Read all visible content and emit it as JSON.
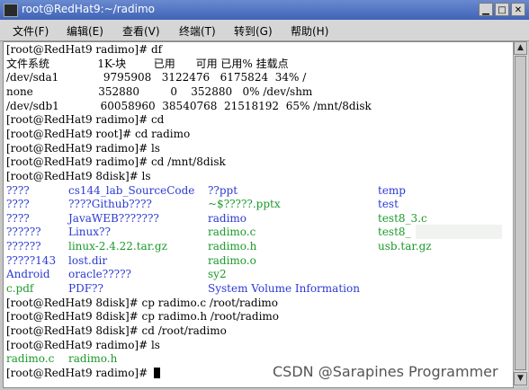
{
  "window": {
    "title": "root@RedHat9:~/radimo"
  },
  "menu": [
    {
      "label": "文件(F)"
    },
    {
      "label": "编辑(E)"
    },
    {
      "label": "查看(V)"
    },
    {
      "label": "终端(T)"
    },
    {
      "label": "转到(G)"
    },
    {
      "label": "帮助(H)"
    }
  ],
  "colors": {
    "dir": "#2a3ad0",
    "file": "#1a9a2a",
    "text": "#000000"
  },
  "terminal": {
    "lines": [
      "[root@RedHat9 radimo]# df",
      "文件系统              1K-块        已用      可用 已用% 挂载点",
      "/dev/sda1             9795908   3122476   6175824  34% /",
      "none                   352880         0    352880   0% /dev/shm",
      "/dev/sdb1            60058960  38540768  21518192  65% /mnt/8disk",
      "[root@RedHat9 radimo]# cd",
      "[root@RedHat9 root]# cd radimo",
      "[root@RedHat9 radimo]# ls",
      "[root@RedHat9 radimo]# cd /mnt/8disk",
      "[root@RedHat9 8disk]# ls"
    ],
    "ls_rows": [
      [
        {
          "t": "????",
          "c": "dir"
        },
        {
          "t": "cs144_lab_SourceCode",
          "c": "dir"
        },
        {
          "t": "??ppt",
          "c": "dir"
        },
        {
          "t": "temp",
          "c": "dir"
        }
      ],
      [
        {
          "t": "????",
          "c": "dir"
        },
        {
          "t": "????Github????",
          "c": "dir"
        },
        {
          "t": "~$?????.pptx",
          "c": "file"
        },
        {
          "t": "test",
          "c": "dir"
        }
      ],
      [
        {
          "t": "????",
          "c": "dir"
        },
        {
          "t": "JavaWEB???????",
          "c": "dir"
        },
        {
          "t": "radimo",
          "c": "dir"
        },
        {
          "t": "test8_3.c",
          "c": "file"
        }
      ],
      [
        {
          "t": "??????",
          "c": "dir"
        },
        {
          "t": "Linux??",
          "c": "dir"
        },
        {
          "t": "radimo.c",
          "c": "file"
        },
        {
          "t": "test8_",
          "c": "file"
        }
      ],
      [
        {
          "t": "??????",
          "c": "dir"
        },
        {
          "t": "linux-2.4.22.tar.gz",
          "c": "file"
        },
        {
          "t": "radimo.h",
          "c": "file"
        },
        {
          "t": "usb.tar.gz",
          "c": "file"
        }
      ],
      [
        {
          "t": "?????143",
          "c": "dir"
        },
        {
          "t": "lost.dir",
          "c": "dir"
        },
        {
          "t": "radimo.o",
          "c": "file"
        },
        {
          "t": "",
          "c": "file"
        }
      ],
      [
        {
          "t": "Android",
          "c": "dir"
        },
        {
          "t": "oracle?????",
          "c": "dir"
        },
        {
          "t": "sy2",
          "c": "file"
        },
        {
          "t": "",
          "c": "file"
        }
      ],
      [
        {
          "t": "c.pdf",
          "c": "file"
        },
        {
          "t": "PDF??",
          "c": "dir"
        },
        {
          "t": "System Volume Information",
          "c": "dir"
        },
        {
          "t": "",
          "c": "file"
        }
      ]
    ],
    "after_lines": [
      "[root@RedHat9 8disk]# cp radimo.c /root/radimo",
      "[root@RedHat9 8disk]# cp radimo.h /root/radimo",
      "[root@RedHat9 8disk]# cd /root/radimo",
      "[root@RedHat9 radimo]# ls"
    ],
    "ls_result": [
      {
        "t": "radimo.c",
        "c": "file"
      },
      {
        "t": "radimo.h",
        "c": "file"
      }
    ],
    "prompt": "[root@RedHat9 radimo]# "
  },
  "watermark": "CSDN @Sarapines Programmer"
}
